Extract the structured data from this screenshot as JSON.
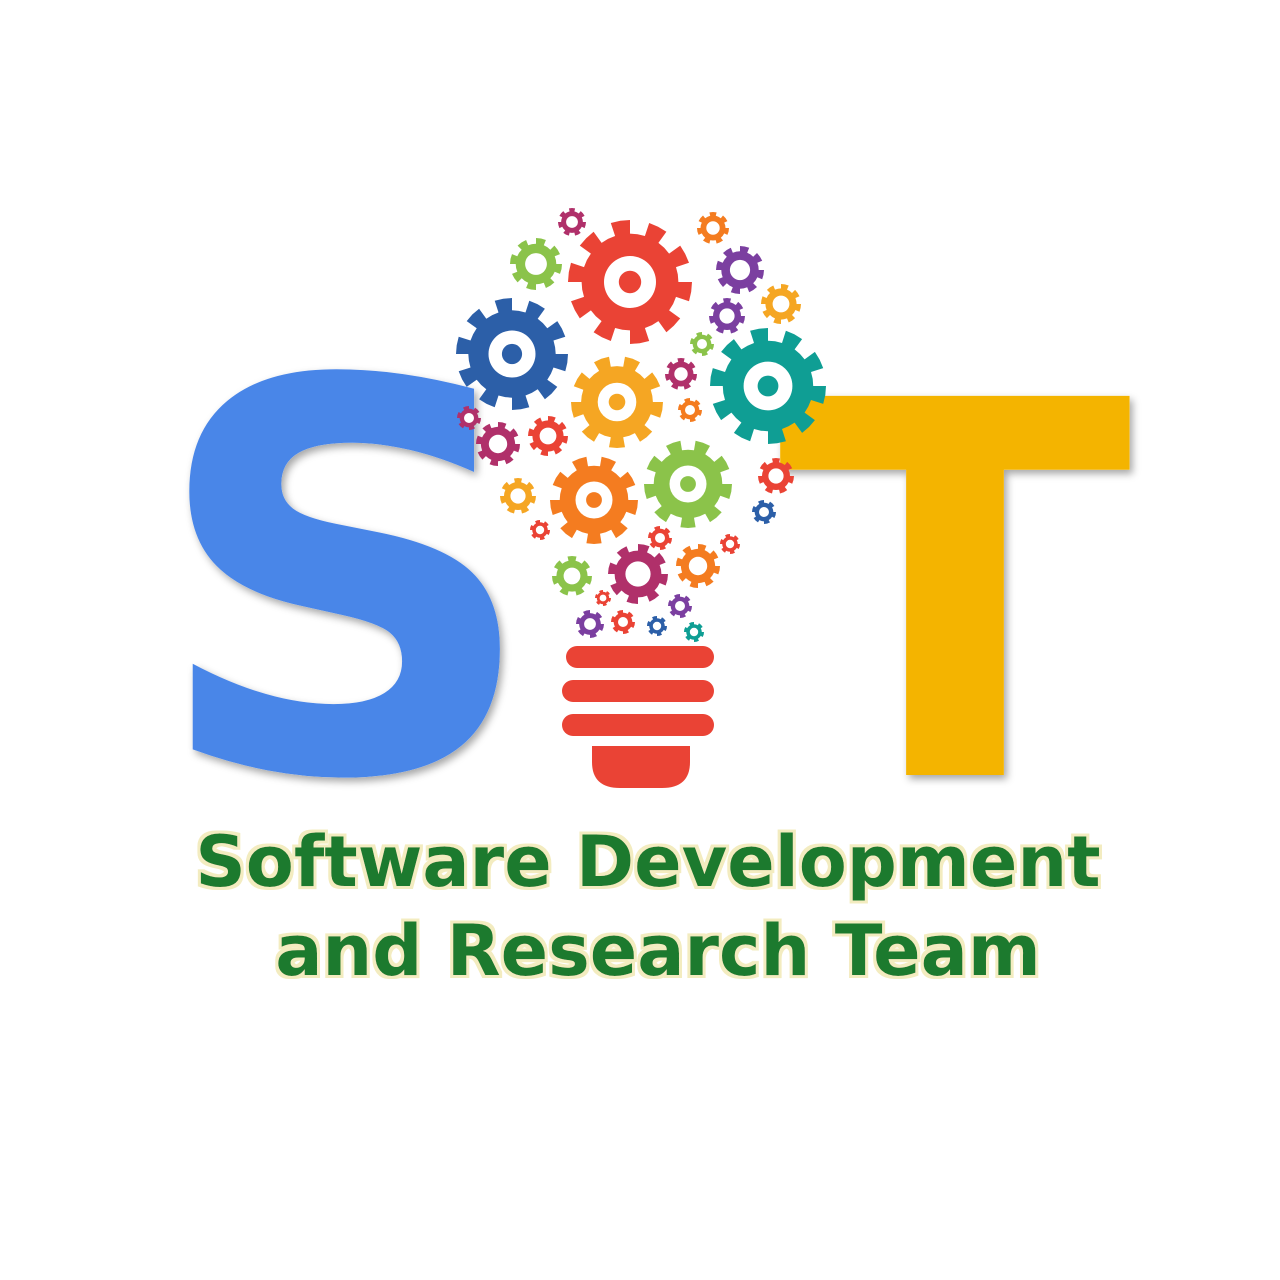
{
  "logo": {
    "left_letter": "S",
    "right_letter": "T",
    "left_letter_color": "#4A86E8",
    "right_letter_color": "#F4B400",
    "bulb_base_color": "#EA4335",
    "tagline_color": "#1E7A2E",
    "tagline_line1": "Software Development",
    "tagline_line2": "and Research Team",
    "gear_colors": [
      "#EA4335",
      "#2C5FA8",
      "#F5A623",
      "#0F9E94",
      "#8BC34A",
      "#7B3FA0",
      "#F47C20",
      "#B0306A"
    ]
  }
}
